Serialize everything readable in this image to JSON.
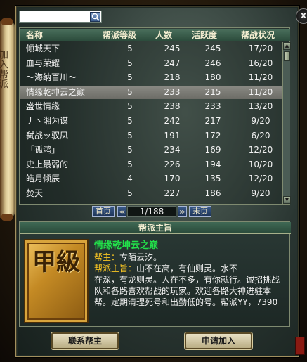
{
  "search": {
    "value": "",
    "placeholder": ""
  },
  "close_label": "x",
  "side_scroll": {
    "text": "加入帮派"
  },
  "table": {
    "headers": {
      "name": "名称",
      "level": "帮派等级",
      "count": "人数",
      "active": "活跃度",
      "war": "帮战状况"
    },
    "rows": [
      {
        "name": "倾城天下",
        "level": "5",
        "count": "245",
        "active": "245",
        "war": "17/20"
      },
      {
        "name": "血与荣耀",
        "level": "5",
        "count": "247",
        "active": "246",
        "war": "16/20"
      },
      {
        "name": "～海纳百川～",
        "level": "5",
        "count": "218",
        "active": "180",
        "war": "11/20"
      },
      {
        "name": "情缘乾坤云之巅",
        "level": "5",
        "count": "233",
        "active": "215",
        "war": "11/20"
      },
      {
        "name": "盛世情缘",
        "level": "5",
        "count": "238",
        "active": "233",
        "war": "13/20"
      },
      {
        "name": "丿丶湘为谋",
        "level": "5",
        "count": "242",
        "active": "217",
        "war": "9/20"
      },
      {
        "name": "弑战ッ驭凤",
        "level": "5",
        "count": "191",
        "active": "172",
        "war": "6/20"
      },
      {
        "name": "「孤鸿」",
        "level": "5",
        "count": "234",
        "active": "169",
        "war": "12/20"
      },
      {
        "name": "史上最弱的",
        "level": "5",
        "count": "226",
        "active": "194",
        "war": "10/20"
      },
      {
        "name": "皓月倾辰",
        "level": "4",
        "count": "170",
        "active": "135",
        "war": "12/20"
      },
      {
        "name": "焚天",
        "level": "5",
        "count": "227",
        "active": "186",
        "war": "9/20"
      }
    ],
    "selected_index": 3
  },
  "pager": {
    "first": "首页",
    "prev": "≪",
    "page_text": "1/188",
    "next": "≫",
    "last": "末页"
  },
  "tenet": {
    "title": "帮派主旨",
    "badge": "甲級",
    "guild_name": "情缘乾坤云之巅",
    "leader_label": "帮主：",
    "leader_value": "ㄘ陌云汐。",
    "motto_label": "帮派主旨：",
    "motto_first": "山不在高，有仙则灵。水不",
    "motto_rest": "在深，有龙则灵。人在不多，有你就行。诚招挑战队和各路喜欢帮战的玩家。欢迎各路大神进驻本帮。定期清理死号和出勤低的号。帮派YY，7390"
  },
  "buttons": {
    "contact": "联系帮主",
    "apply": "申请加入"
  },
  "colors": {
    "guild_name": "#22e04a",
    "label_yellow": "#f6c423",
    "selected_row": "#7c7c76",
    "header_green": "#3f6854"
  }
}
